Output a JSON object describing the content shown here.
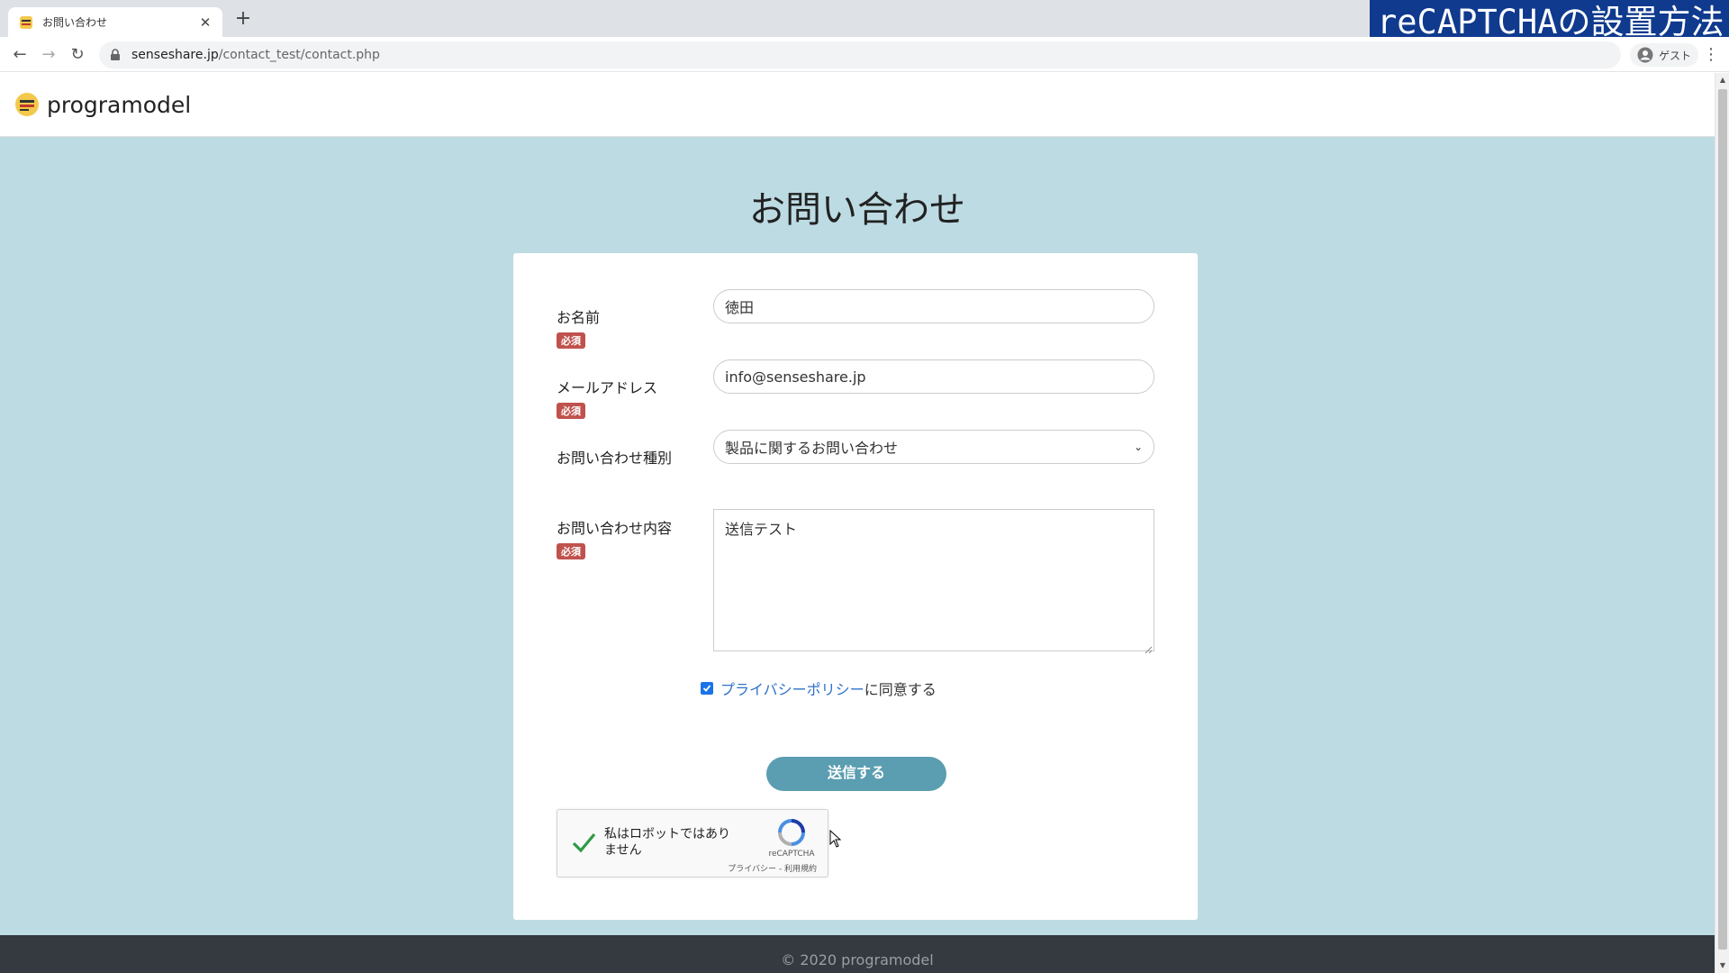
{
  "browser": {
    "tab_title": "お問い合わせ",
    "url_host": "senseshare.jp",
    "url_path": "/contact_test/contact.php",
    "profile_label": "ゲスト"
  },
  "overlay": {
    "title": "reCAPTCHAの設置方法"
  },
  "site": {
    "logo_text": "programodel",
    "footer": "© 2020 programodel"
  },
  "page": {
    "title": "お問い合わせ"
  },
  "form": {
    "required_badge": "必須",
    "name": {
      "label": "お名前",
      "value": "徳田"
    },
    "email": {
      "label": "メールアドレス",
      "value": "info@senseshare.jp"
    },
    "type": {
      "label": "お問い合わせ種別",
      "selected": "製品に関するお問い合わせ"
    },
    "message": {
      "label": "お問い合わせ内容",
      "value": "送信テスト"
    },
    "privacy": {
      "checked": true,
      "link_text": "プライバシーポリシー",
      "suffix": "に同意する"
    },
    "submit_label": "送信する"
  },
  "recaptcha": {
    "label": "私はロボットではありません",
    "brand": "reCAPTCHA",
    "terms": "プライバシー - 利用規約"
  },
  "colors": {
    "page_bg": "#bddbe3",
    "button": "#5b9db1",
    "badge": "#c0524d",
    "link": "#2f72c9",
    "footer": "#343a40",
    "overlay": "#0f3a8e"
  }
}
